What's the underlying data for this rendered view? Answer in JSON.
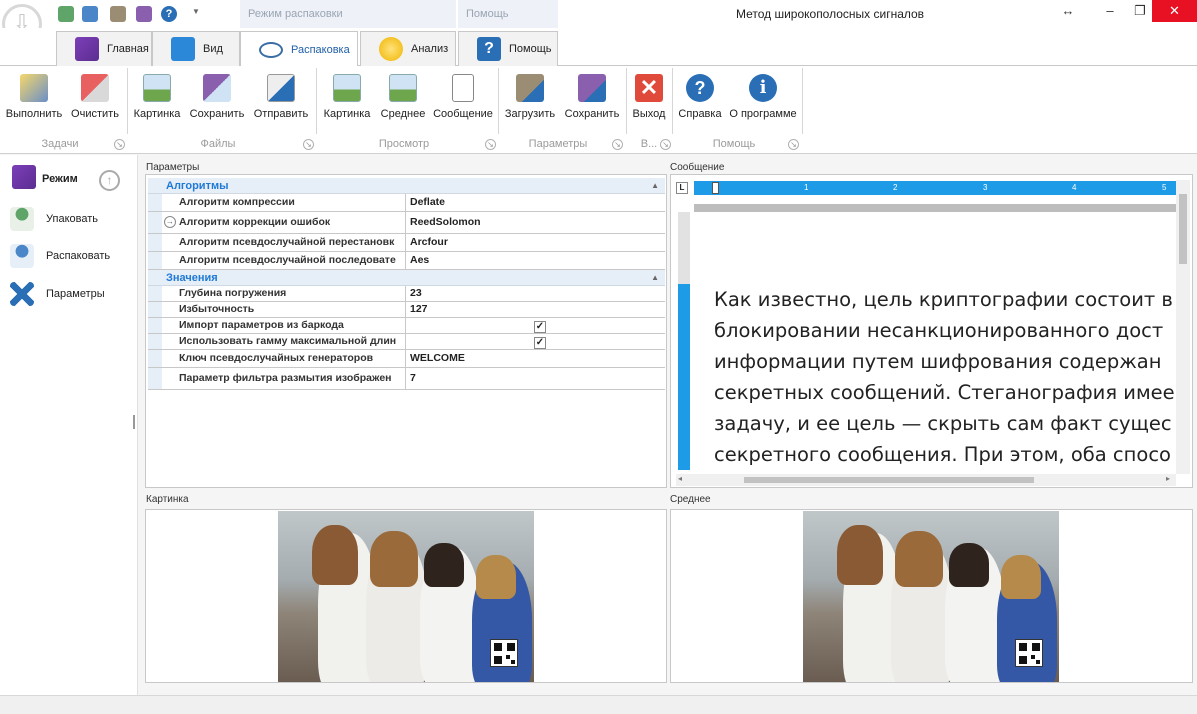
{
  "window": {
    "title": "Метод широкополосных сигналов",
    "context_tab_unpack": "Режим распаковки",
    "context_tab_help": "Помощь",
    "controls": {
      "restore": "↔",
      "minimize": "–",
      "maximize": "❐",
      "close": "✕"
    }
  },
  "tabs": [
    {
      "label": "Главная",
      "icon": "visual-studio-icon"
    },
    {
      "label": "Вид",
      "icon": "windows-icon"
    },
    {
      "label": "Распаковка",
      "icon": "eye-icon",
      "active": true
    },
    {
      "label": "Анализ",
      "icon": "lightbulb-icon"
    },
    {
      "label": "Помощь",
      "icon": "help-book-icon"
    }
  ],
  "ribbon": {
    "buttons": {
      "execute": "Выполнить",
      "clear": "Очистить",
      "picture": "Картинка",
      "save": "Сохранить",
      "send": "Отправить",
      "view_picture": "Картинка",
      "view_average": "Среднее",
      "view_message": "Сообщение",
      "load": "Загрузить",
      "save_params": "Сохранить",
      "exit": "Выход",
      "help": "Справка",
      "about": "О программе"
    },
    "groups": {
      "tasks": "Задачи",
      "files": "Файлы",
      "view": "Просмотр",
      "params": "Параметры",
      "exit_short": "В...",
      "help": "Помощь"
    }
  },
  "nav": {
    "header": "Режим",
    "items": [
      "Упаковать",
      "Распаковать",
      "Параметры"
    ]
  },
  "panels": {
    "params": "Параметры",
    "message": "Сообщение",
    "picture": "Картинка",
    "average": "Среднее"
  },
  "propgrid": {
    "cat_algorithms": "Алгоритмы",
    "cat_values": "Значения",
    "algorithms": [
      {
        "name": "Алгоритм компрессии",
        "value": "Deflate"
      },
      {
        "name": "Алгоритм коррекции ошибок",
        "value": "ReedSolomon"
      },
      {
        "name": "Алгоритм псевдослучайной перестановк",
        "value": "Arcfour"
      },
      {
        "name": "Алгоритм псевдослучайной последовате",
        "value": "Aes"
      }
    ],
    "values": [
      {
        "name": "Глубина погружения",
        "value": "23"
      },
      {
        "name": "Избыточность",
        "value": "127"
      },
      {
        "name": "Импорт параметров из баркода",
        "checked": true
      },
      {
        "name": "Использовать гамму максимальной длин",
        "checked": true
      },
      {
        "name": "Ключ псевдослучайных генераторов",
        "value": "WELCOME"
      },
      {
        "name": "Параметр фильтра размытия изображен",
        "value": "7"
      }
    ]
  },
  "ruler": {
    "marks": [
      "1",
      "2",
      "3",
      "4",
      "5"
    ],
    "corner": "L"
  },
  "message": {
    "lines": [
      "Как известно, цель криптографии состоит в",
      "блокировании несанкционированного дост",
      "информации путем шифрования содержан",
      "секретных сообщений. Стеганография имее",
      "задачу, и ее цель — скрыть сам факт сущес",
      "секретного сообщения. При этом, оба спосо"
    ]
  },
  "colors": {
    "accent": "#1e9be6",
    "category_text": "#1f7ad6",
    "exit_red": "#e04a3a",
    "help_blue": "#2a6fb5"
  }
}
